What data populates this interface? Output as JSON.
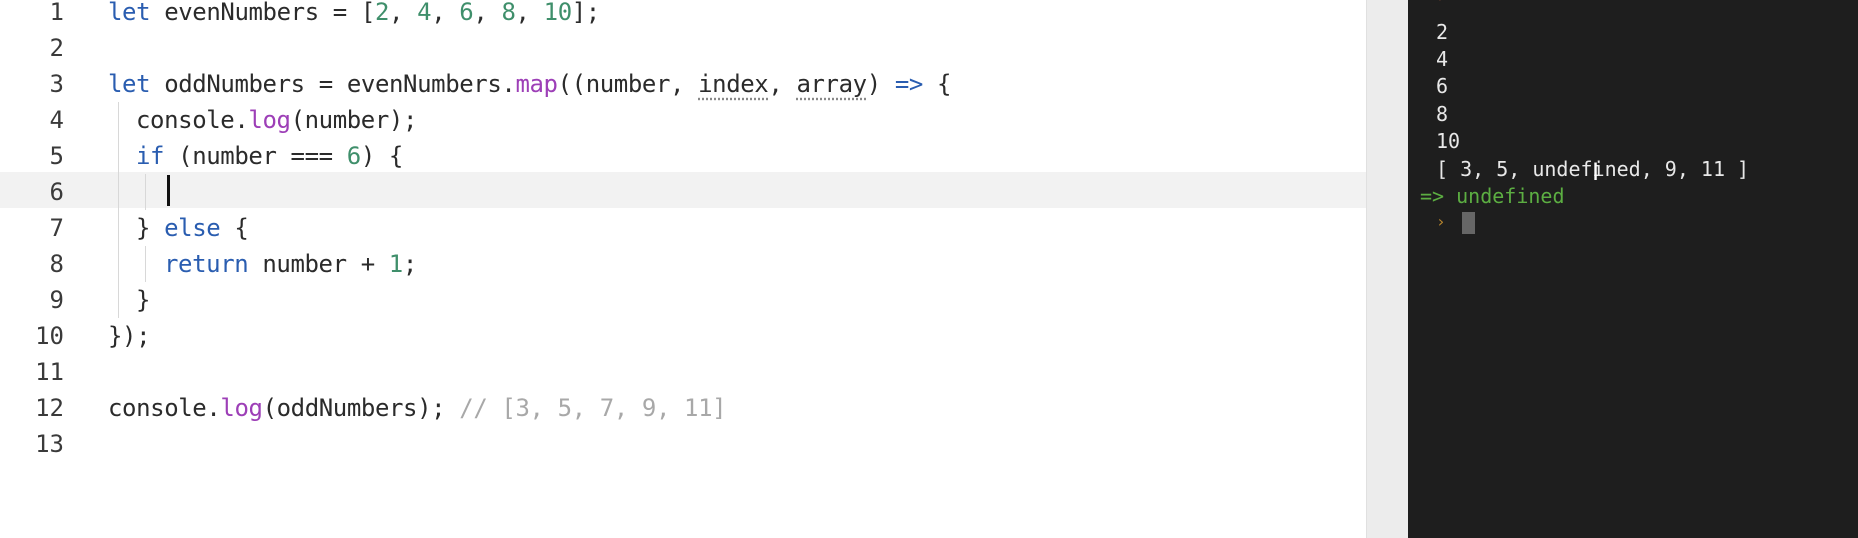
{
  "editor": {
    "line_numbers": [
      "1",
      "2",
      "3",
      "4",
      "5",
      "6",
      "7",
      "8",
      "9",
      "10",
      "11",
      "12",
      "13"
    ],
    "active_line": "6",
    "lines": {
      "l1": {
        "kw": "let",
        "rest": " evenNumbers = [",
        "n1": "2",
        "c1": ", ",
        "n2": "4",
        "c2": ", ",
        "n3": "6",
        "c3": ", ",
        "n4": "8",
        "c4": ", ",
        "n5": "10",
        "end": "];"
      },
      "l3": {
        "kw": "let",
        "a": " oddNumbers = evenNumbers.",
        "fn": "map",
        "b": "((number, ",
        "p1": "index",
        "c": ", ",
        "p2": "array",
        "d": ") ",
        "arrow": "=>",
        "e": " {"
      },
      "l4": {
        "a": "console.",
        "fn": "log",
        "b": "(number);"
      },
      "l5": {
        "kw": "if",
        "a": " (number === ",
        "num": "6",
        "b": ") {"
      },
      "l7": {
        "a": "} ",
        "kw": "else",
        "b": " {"
      },
      "l8": {
        "kw": "return",
        "a": " number + ",
        "num": "1",
        "b": ";"
      },
      "l9": {
        "a": "}"
      },
      "l10": {
        "a": "});"
      },
      "l12": {
        "a": "console.",
        "fn": "log",
        "b": "(oddNumbers); ",
        "cmt": "// [3, 5, 7, 9, 11]"
      }
    }
  },
  "console": {
    "outputs": [
      "2",
      "4",
      "6",
      "8",
      "10"
    ],
    "array_output": "[ 3, 5, undefined, 9, 11 ]",
    "return_arrow": "=>",
    "return_value": "undefined",
    "prompt_symbol": "›"
  },
  "colors": {
    "keyword": "#2a5db0",
    "number": "#3f8f6b",
    "function": "#9d3fb7",
    "comment": "#a8a8a8",
    "console_bg": "#1e1e1e",
    "return_green": "#5cae42"
  }
}
